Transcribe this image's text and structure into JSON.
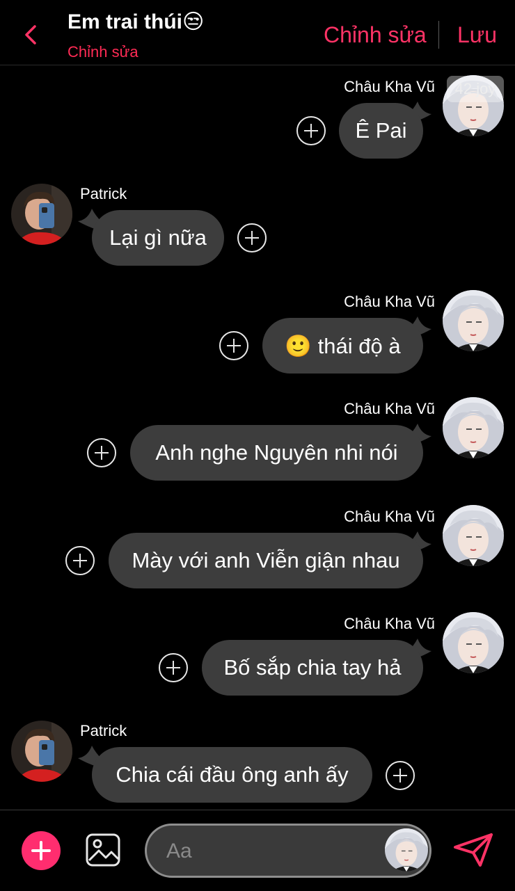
{
  "header": {
    "title": "Em trai thúi😒",
    "subtitle": "Chỉnh sửa",
    "edit_label": "Chỉnh sửa",
    "save_label": "Lưu"
  },
  "colors": {
    "accent": "#ff3366",
    "bubble": "#3d3d3d",
    "background": "#000000"
  },
  "overlay": {
    "badge": "42 joy"
  },
  "messages": [
    {
      "sender": "Châu Kha Vũ",
      "side": "right",
      "text": "Ê Pai"
    },
    {
      "sender": "Patrick",
      "side": "left",
      "text": "Lại gì nữa"
    },
    {
      "sender": "Châu Kha Vũ",
      "side": "right",
      "text": "🙂 thái độ à"
    },
    {
      "sender": "Châu Kha Vũ",
      "side": "right",
      "text": "Anh nghe Nguyên nhi nói"
    },
    {
      "sender": "Châu Kha Vũ",
      "side": "right",
      "text": "Mày với anh Viễn giận nhau"
    },
    {
      "sender": "Châu Kha Vũ",
      "side": "right",
      "text": "Bố sắp chia tay hả"
    },
    {
      "sender": "Patrick",
      "side": "left",
      "text": "Chia cái đầu ông anh ấy"
    }
  ],
  "composer": {
    "placeholder": "Aa"
  },
  "icons": [
    "back-chevron-icon",
    "add-icon",
    "image-icon",
    "send-icon"
  ]
}
